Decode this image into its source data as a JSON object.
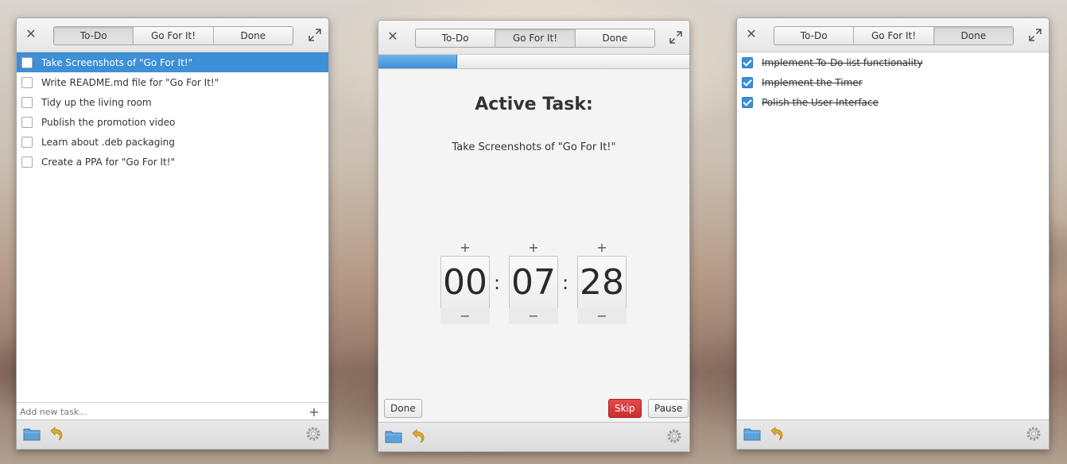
{
  "tabs": [
    "To-Do",
    "Go For It!",
    "Done"
  ],
  "todo_window": {
    "active_tab": "To-Do",
    "tasks": [
      {
        "label": "Take Screenshots of \"Go For It!\"",
        "selected": true
      },
      {
        "label": "Write README.md file for \"Go For It!\"",
        "selected": false
      },
      {
        "label": "Tidy up the living room",
        "selected": false
      },
      {
        "label": "Publish the promotion video",
        "selected": false
      },
      {
        "label": "Learn about .deb packaging",
        "selected": false
      },
      {
        "label": "Create a PPA for \"Go For It!\"",
        "selected": false
      }
    ],
    "add_placeholder": "Add new task...",
    "add_button": "+"
  },
  "timer_window": {
    "active_tab": "Go For It!",
    "progress_fraction": 0.25,
    "title": "Active Task:",
    "task": "Take Screenshots of \"Go For It!\"",
    "hours": "00",
    "minutes": "07",
    "seconds": "28",
    "separator": ":",
    "plus": "+",
    "minus": "−",
    "done_button": "Done",
    "skip_button": "Skip",
    "pause_button": "Pause"
  },
  "done_window": {
    "active_tab": "Done",
    "tasks": [
      {
        "label": "Implement To-Do list functionality"
      },
      {
        "label": "Implement the Timer"
      },
      {
        "label": "Polish the User Interface"
      }
    ]
  },
  "icons": {
    "close": "close-icon",
    "maximize": "maximize-icon",
    "folder": "folder-icon",
    "undo": "undo-icon",
    "settings": "gear-icon"
  },
  "colors": {
    "accent": "#3d8fd6",
    "skip": "#d63b3b",
    "undo": "#e0a82e",
    "folder": "#5fa2d9"
  }
}
